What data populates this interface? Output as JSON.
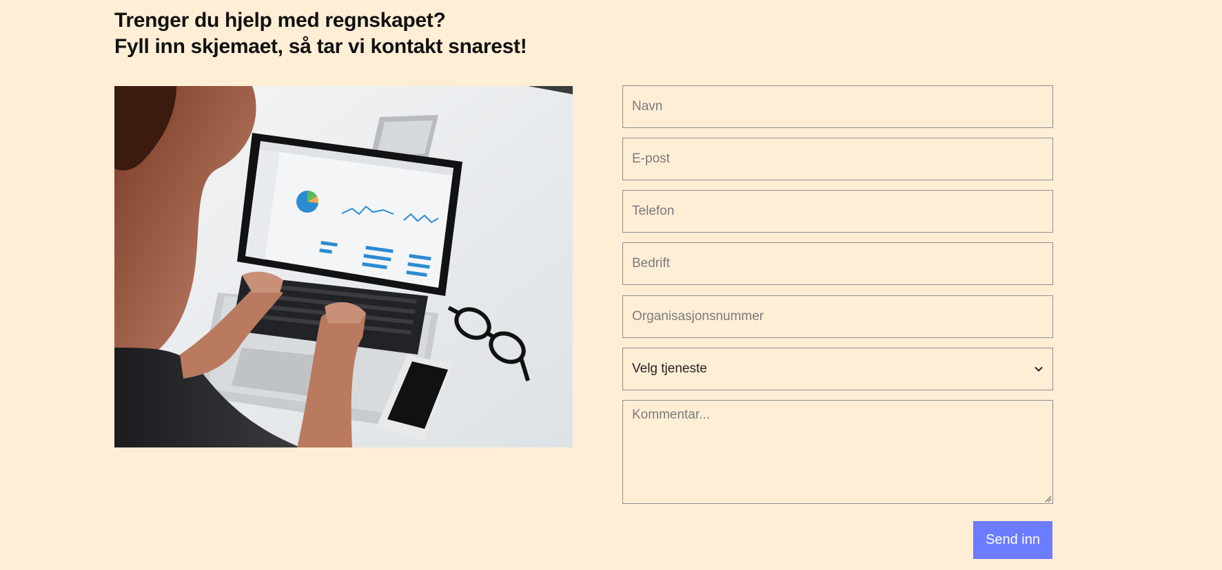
{
  "heading": {
    "line1": "Trenger du hjelp med regnskapet?",
    "line2": "Fyll inn skjemaet, så tar vi kontakt snarest!"
  },
  "image": {
    "alt": "Person som jobber på en bærbar PC med grafer og diagrammer"
  },
  "form": {
    "name_placeholder": "Navn",
    "email_placeholder": "E-post",
    "phone_placeholder": "Telefon",
    "company_placeholder": "Bedrift",
    "orgnr_placeholder": "Organisasjonsnummer",
    "service_selected": "Velg tjeneste",
    "comment_placeholder": "Kommentar...",
    "submit_label": "Send inn"
  },
  "colors": {
    "background": "#ffeed6",
    "button": "#6c7cff",
    "field_border": "#8d8d8d"
  },
  "icons": {
    "select": "chevron-down-icon",
    "textarea": "resize-handle-icon"
  }
}
